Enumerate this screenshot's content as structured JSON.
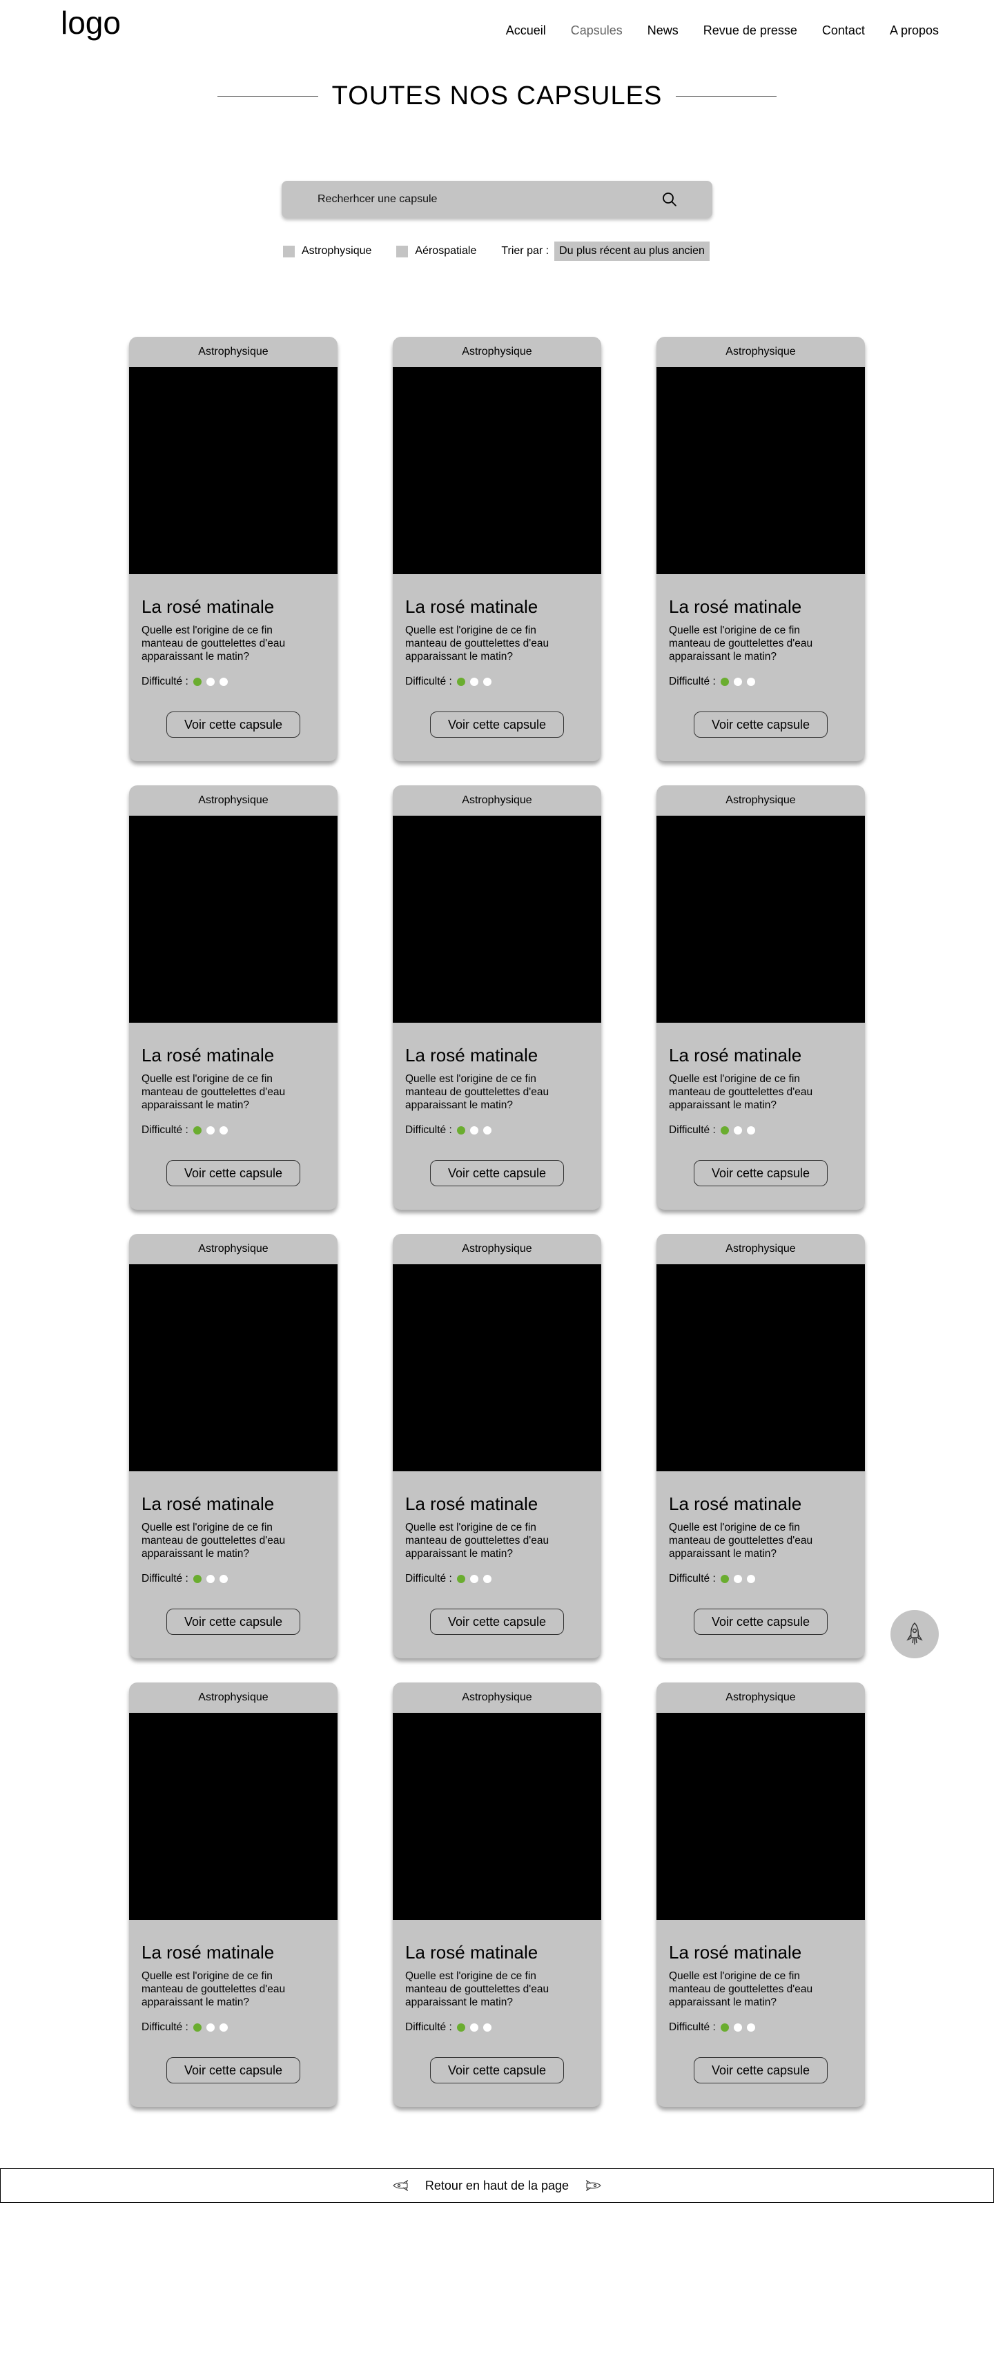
{
  "header": {
    "logo": "logo",
    "nav": [
      "Accueil",
      "Capsules",
      "News",
      "Revue de presse",
      "Contact",
      "A propos"
    ],
    "active": "Capsules"
  },
  "page": {
    "title": "TOUTES NOS CAPSULES"
  },
  "search": {
    "placeholder": "Recherhcer une capsule",
    "icon": "search-icon"
  },
  "filters": {
    "categories": [
      "Astrophysique",
      "Aérospatiale"
    ],
    "sort_label": "Trier par :",
    "sort_value": "Du plus récent au plus ancien"
  },
  "cards": [
    {
      "category": "Astrophysique",
      "title": "La rosé matinale",
      "description": "Quelle est l'origine de ce fin manteau de gouttelettes d'eau apparaissant le matin?",
      "difficulty_label": "Difficulté :",
      "difficulty": 1,
      "difficulty_max": 3,
      "button": "Voir cette capsule"
    },
    {
      "category": "Astrophysique",
      "title": "La rosé matinale",
      "description": "Quelle est l'origine de ce fin manteau de gouttelettes d'eau apparaissant le matin?",
      "difficulty_label": "Difficulté :",
      "difficulty": 1,
      "difficulty_max": 3,
      "button": "Voir cette capsule"
    },
    {
      "category": "Astrophysique",
      "title": "La rosé matinale",
      "description": "Quelle est l'origine de ce fin manteau de gouttelettes d'eau apparaissant le matin?",
      "difficulty_label": "Difficulté :",
      "difficulty": 1,
      "difficulty_max": 3,
      "button": "Voir cette capsule"
    },
    {
      "category": "Astrophysique",
      "title": "La rosé matinale",
      "description": "Quelle est l'origine de ce fin manteau de gouttelettes d'eau apparaissant le matin?",
      "difficulty_label": "Difficulté :",
      "difficulty": 1,
      "difficulty_max": 3,
      "button": "Voir cette capsule"
    },
    {
      "category": "Astrophysique",
      "title": "La rosé matinale",
      "description": "Quelle est l'origine de ce fin manteau de gouttelettes d'eau apparaissant le matin?",
      "difficulty_label": "Difficulté :",
      "difficulty": 1,
      "difficulty_max": 3,
      "button": "Voir cette capsule"
    },
    {
      "category": "Astrophysique",
      "title": "La rosé matinale",
      "description": "Quelle est l'origine de ce fin manteau de gouttelettes d'eau apparaissant le matin?",
      "difficulty_label": "Difficulté :",
      "difficulty": 1,
      "difficulty_max": 3,
      "button": "Voir cette capsule"
    },
    {
      "category": "Astrophysique",
      "title": "La rosé matinale",
      "description": "Quelle est l'origine de ce fin manteau de gouttelettes d'eau apparaissant le matin?",
      "difficulty_label": "Difficulté :",
      "difficulty": 1,
      "difficulty_max": 3,
      "button": "Voir cette capsule"
    },
    {
      "category": "Astrophysique",
      "title": "La rosé matinale",
      "description": "Quelle est l'origine de ce fin manteau de gouttelettes d'eau apparaissant le matin?",
      "difficulty_label": "Difficulté :",
      "difficulty": 1,
      "difficulty_max": 3,
      "button": "Voir cette capsule"
    },
    {
      "category": "Astrophysique",
      "title": "La rosé matinale",
      "description": "Quelle est l'origine de ce fin manteau de gouttelettes d'eau apparaissant le matin?",
      "difficulty_label": "Difficulté :",
      "difficulty": 1,
      "difficulty_max": 3,
      "button": "Voir cette capsule"
    },
    {
      "category": "Astrophysique",
      "title": "La rosé matinale",
      "description": "Quelle est l'origine de ce fin manteau de gouttelettes d'eau apparaissant le matin?",
      "difficulty_label": "Difficulté :",
      "difficulty": 1,
      "difficulty_max": 3,
      "button": "Voir cette capsule"
    },
    {
      "category": "Astrophysique",
      "title": "La rosé matinale",
      "description": "Quelle est l'origine de ce fin manteau de gouttelettes d'eau apparaissant le matin?",
      "difficulty_label": "Difficulté :",
      "difficulty": 1,
      "difficulty_max": 3,
      "button": "Voir cette capsule"
    },
    {
      "category": "Astrophysique",
      "title": "La rosé matinale",
      "description": "Quelle est l'origine de ce fin manteau de gouttelettes d'eau apparaissant le matin?",
      "difficulty_label": "Difficulté :",
      "difficulty": 1,
      "difficulty_max": 3,
      "button": "Voir cette capsule"
    }
  ],
  "fab": {
    "icon": "rocket-icon"
  },
  "footer": {
    "back_to_top": "Retour en haut de la page",
    "icon": "rocket-icon"
  },
  "colors": {
    "card_bg": "#c4c4c4",
    "difficulty_on": "#6aad2f",
    "difficulty_off": "#ffffff",
    "nav_active": "#666666"
  }
}
